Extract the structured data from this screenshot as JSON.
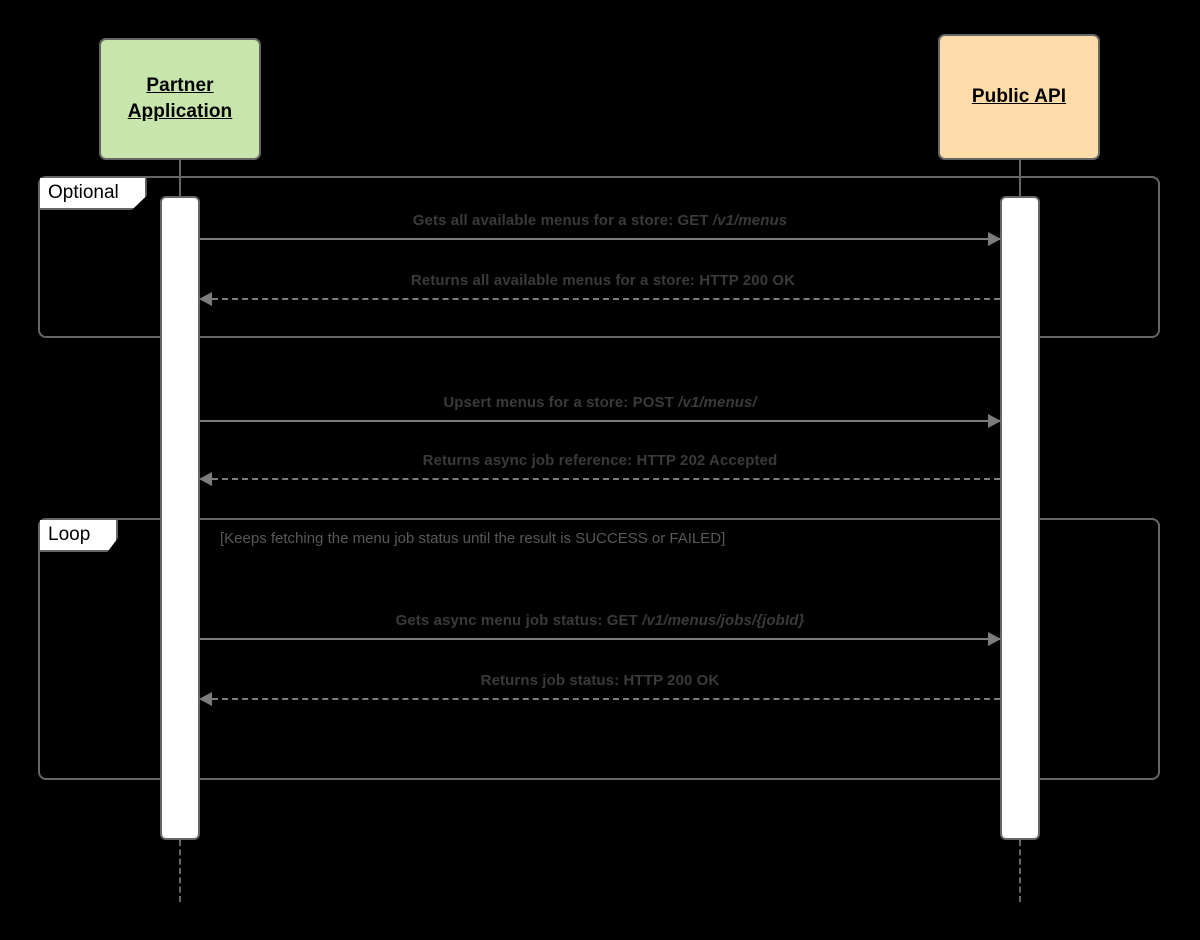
{
  "diagram": {
    "type": "sequence-diagram",
    "title": "",
    "colors": {
      "participant_partner_fill": "#c8e6ac",
      "participant_api_fill": "#ffdca8",
      "border": "#666666",
      "message_line": "#7c7c7c",
      "message_text": "#3a3a3a",
      "condition_text": "#585858",
      "background": "#000000",
      "activation_fill": "#ffffff"
    },
    "participants": [
      {
        "id": "partner",
        "label": "Partner\nApplication",
        "label_line1": "Partner",
        "label_line2": "Application"
      },
      {
        "id": "api",
        "label": "Public API",
        "label_line1": "Public API",
        "label_line2": ""
      }
    ],
    "fragments": [
      {
        "id": "optional",
        "tag": "Optional",
        "condition": ""
      },
      {
        "id": "loop",
        "tag": "Loop",
        "condition": "[Keeps fetching the menu job status until the result is SUCCESS or FAILED]"
      }
    ],
    "messages": [
      {
        "id": "m1",
        "text": "Gets all available menus for a store: GET /v1/menus",
        "text_plain": "Gets all available menus for a store: GET ",
        "text_italic": "/v1/menus",
        "from": "partner",
        "to": "api",
        "style": "solid",
        "direction": "right"
      },
      {
        "id": "m2",
        "text": "Returns all available menus for a store: HTTP 200 OK",
        "text_plain": "Returns all available menus for a store: HTTP 200 OK",
        "text_italic": "",
        "from": "api",
        "to": "partner",
        "style": "dashed",
        "direction": "left"
      },
      {
        "id": "m3",
        "text": "Upsert menus for a store: POST /v1/menus/",
        "text_plain": "Upsert menus for a store: POST ",
        "text_italic": "/v1/menus/",
        "from": "partner",
        "to": "api",
        "style": "solid",
        "direction": "right"
      },
      {
        "id": "m4",
        "text": "Returns async job reference: HTTP 202 Accepted",
        "text_plain": "Returns async job reference: HTTP 202 Accepted",
        "text_italic": "",
        "from": "api",
        "to": "partner",
        "style": "dashed",
        "direction": "left"
      },
      {
        "id": "m5",
        "text": "Gets async menu job status: GET /v1/menus/jobs/{jobId}",
        "text_plain": "Gets async menu job status: GET ",
        "text_italic": "/v1/menus/jobs/{jobId}",
        "from": "partner",
        "to": "api",
        "style": "solid",
        "direction": "right"
      },
      {
        "id": "m6",
        "text": "Returns job status: HTTP 200 OK",
        "text_plain": "Returns job status: HTTP 200 OK",
        "text_italic": "",
        "from": "api",
        "to": "partner",
        "style": "dashed",
        "direction": "left"
      }
    ]
  }
}
